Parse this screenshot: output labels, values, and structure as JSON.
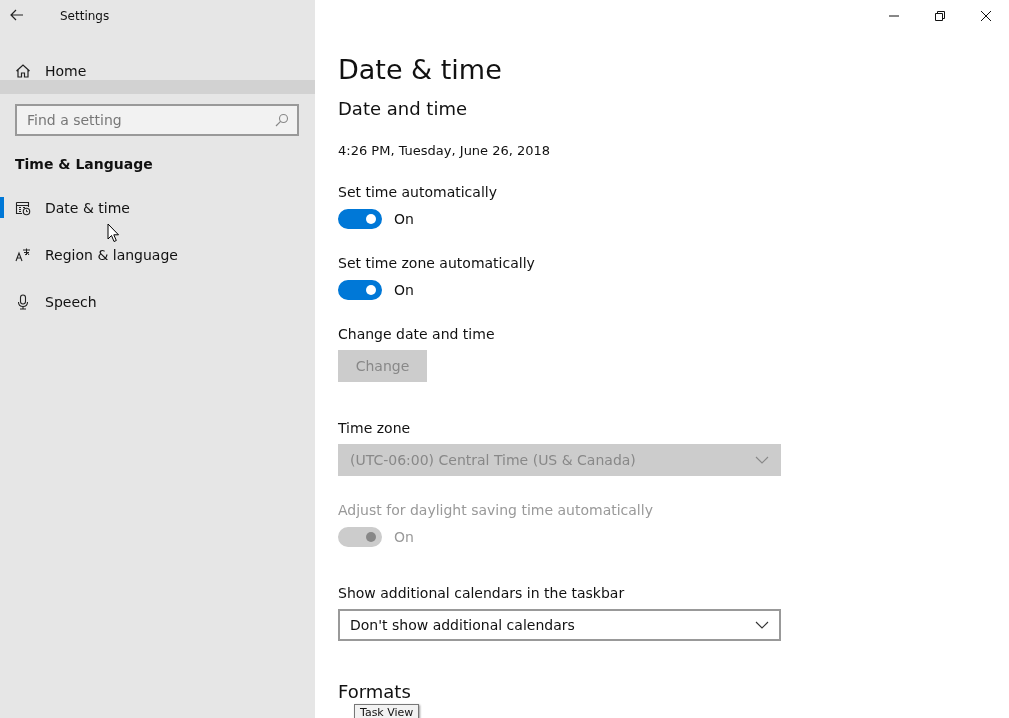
{
  "window": {
    "title": "Settings"
  },
  "sidebar": {
    "home": "Home",
    "search": {
      "placeholder": "Find a setting"
    },
    "section": "Time & Language",
    "items": [
      {
        "label": "Date & time",
        "kind": "calendar",
        "selected": true
      },
      {
        "label": "Region & language",
        "kind": "language",
        "selected": false
      },
      {
        "label": "Speech",
        "kind": "microphone",
        "selected": false
      }
    ]
  },
  "page": {
    "title": "Date & time",
    "subtitle": "Date and time",
    "settings": [
      {
        "kind": "text",
        "text": "4:26 PM, Tuesday, June 26, 2018"
      },
      {
        "kind": "toggle",
        "label": "Set time automatically",
        "on": true,
        "disabled": false,
        "state_text": "On"
      },
      {
        "kind": "toggle",
        "label": "Set time zone automatically",
        "on": true,
        "disabled": false,
        "state_text": "On"
      },
      {
        "kind": "button",
        "label": "Change date and time",
        "button": "Change",
        "disabled": true
      },
      {
        "kind": "dropdown",
        "label": "Time zone",
        "value": "(UTC-06:00) Central Time (US & Canada)",
        "disabled": true
      },
      {
        "kind": "toggle",
        "label": "Adjust for daylight saving time automatically",
        "on": true,
        "disabled": true,
        "state_text": "On"
      },
      {
        "kind": "dropdown",
        "label": "Show additional calendars in the taskbar",
        "value": "Don't show additional calendars",
        "disabled": false
      }
    ],
    "next_section": "Formats"
  },
  "tooltip": "Task View"
}
